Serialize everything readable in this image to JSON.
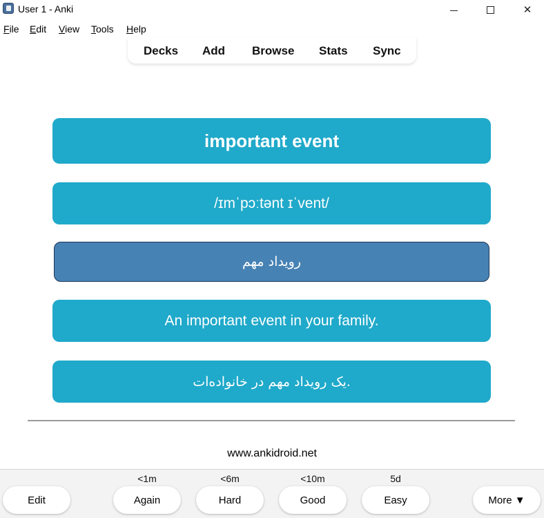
{
  "window": {
    "title": "User 1 - Anki"
  },
  "menu": {
    "items": [
      {
        "accel": "F",
        "rest": "ile"
      },
      {
        "accel": "E",
        "rest": "dit"
      },
      {
        "accel": "V",
        "rest": "iew"
      },
      {
        "accel": "T",
        "rest": "ools"
      },
      {
        "accel": "H",
        "rest": "elp"
      }
    ]
  },
  "toolbar": {
    "decks": "Decks",
    "add": "Add",
    "browse": "Browse",
    "stats": "Stats",
    "sync": "Sync"
  },
  "card": {
    "word": "important event",
    "phonetic": "/ɪmˈpɔːtənt ɪˈvent/",
    "translation": "رویداد مهم",
    "example": "An important event in your family.",
    "example_translation": ".یک رویداد مهم در خانواده‌ات"
  },
  "footer": {
    "site": "www.ankidroid.net"
  },
  "bottom": {
    "edit": "Edit",
    "again": {
      "label": "Again",
      "interval": "<1m"
    },
    "hard": {
      "label": "Hard",
      "interval": "<6m"
    },
    "good": {
      "label": "Good",
      "interval": "<10m"
    },
    "easy": {
      "label": "Easy",
      "interval": "5d"
    },
    "more": "More ▼"
  }
}
